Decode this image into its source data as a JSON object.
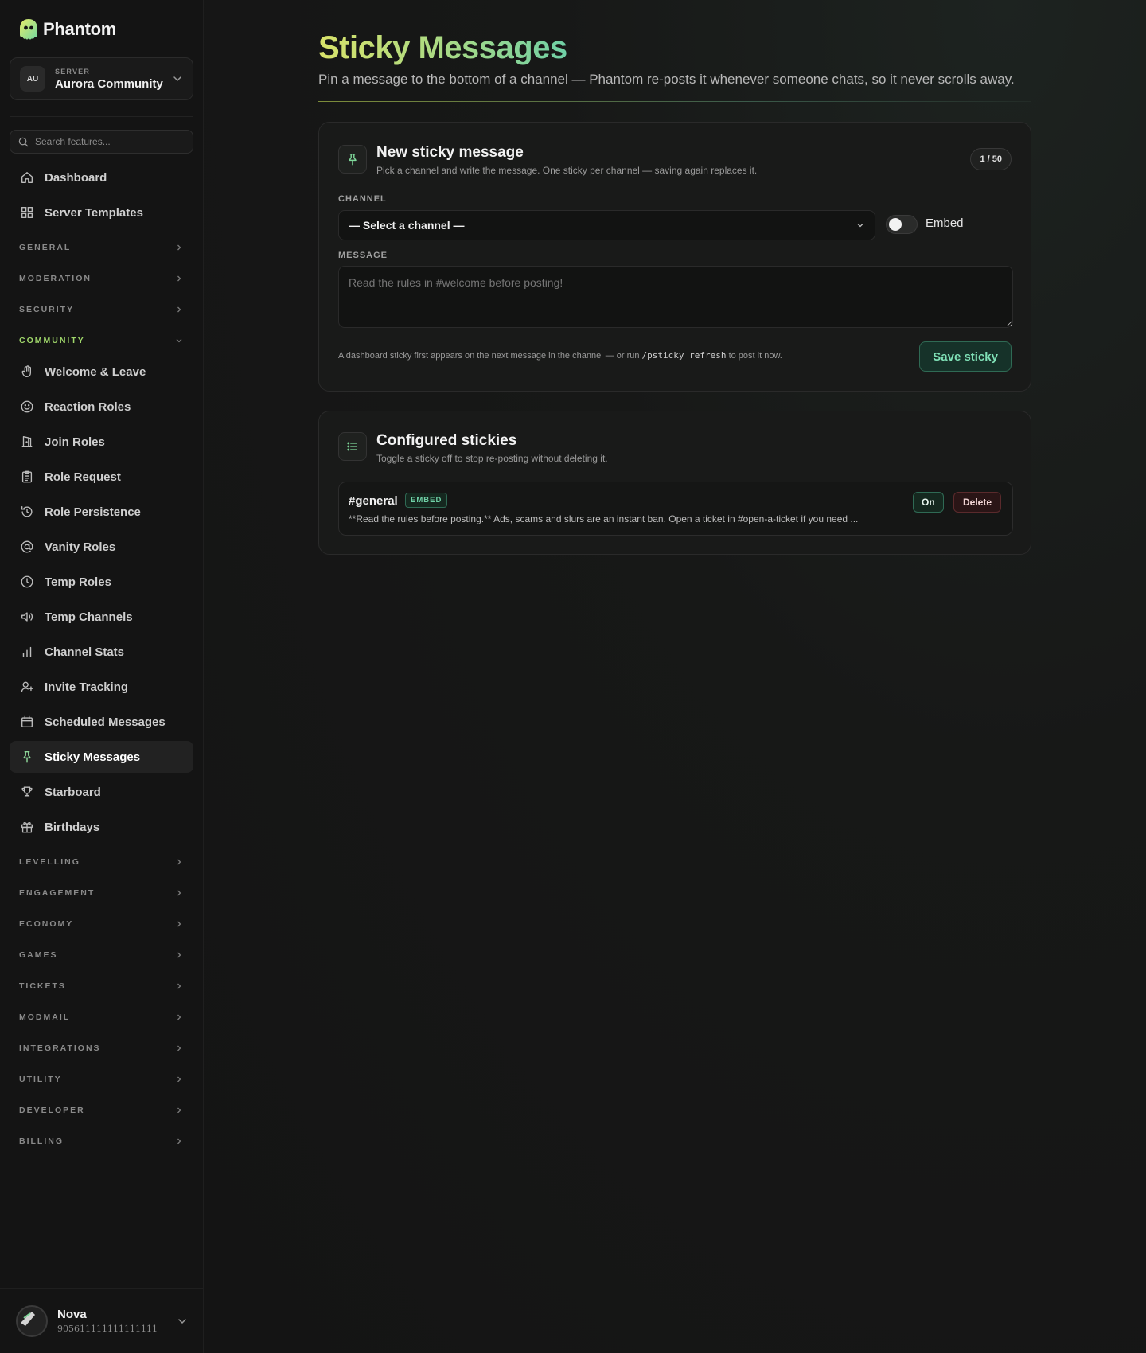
{
  "brand": {
    "name": "Phantom"
  },
  "server": {
    "initials": "AU",
    "label": "SERVER",
    "name": "Aurora Community"
  },
  "search": {
    "placeholder": "Search features..."
  },
  "sidebar": {
    "top_items": [
      {
        "label": "Dashboard",
        "icon": "home-icon"
      },
      {
        "label": "Server Templates",
        "icon": "grid-icon"
      }
    ],
    "sections_before": [
      "GENERAL",
      "MODERATION",
      "SECURITY"
    ],
    "open_section": "COMMUNITY",
    "community_items": [
      {
        "label": "Welcome & Leave",
        "icon": "hand-icon"
      },
      {
        "label": "Reaction Roles",
        "icon": "smile-icon"
      },
      {
        "label": "Join Roles",
        "icon": "door-icon"
      },
      {
        "label": "Role Request",
        "icon": "clipboard-icon"
      },
      {
        "label": "Role Persistence",
        "icon": "history-icon"
      },
      {
        "label": "Vanity Roles",
        "icon": "at-icon"
      },
      {
        "label": "Temp Roles",
        "icon": "clock-icon"
      },
      {
        "label": "Temp Channels",
        "icon": "speaker-icon"
      },
      {
        "label": "Channel Stats",
        "icon": "bar-chart-icon"
      },
      {
        "label": "Invite Tracking",
        "icon": "user-plus-icon"
      },
      {
        "label": "Scheduled Messages",
        "icon": "calendar-icon"
      },
      {
        "label": "Sticky Messages",
        "icon": "pin-icon",
        "active": true
      },
      {
        "label": "Starboard",
        "icon": "trophy-icon"
      },
      {
        "label": "Birthdays",
        "icon": "gift-icon"
      }
    ],
    "sections_after": [
      "LEVELLING",
      "ENGAGEMENT",
      "ECONOMY",
      "GAMES",
      "TICKETS",
      "MODMAIL",
      "INTEGRATIONS",
      "UTILITY",
      "DEVELOPER",
      "BILLING"
    ]
  },
  "user": {
    "name": "Nova",
    "id": "905611111111111111"
  },
  "page": {
    "title": "Sticky Messages",
    "subtitle": "Pin a message to the bottom of a channel — Phantom re-posts it whenever someone chats, so it never scrolls away."
  },
  "new_card": {
    "title": "New sticky message",
    "description": "Pick a channel and write the message. One sticky per channel — saving again replaces it.",
    "count": "1 / 50",
    "channel_label": "CHANNEL",
    "channel_value": "— Select a channel —",
    "embed_label": "Embed",
    "embed_on": false,
    "message_label": "MESSAGE",
    "message_placeholder": "Read the rules in #welcome before posting!",
    "hint_before": "A dashboard sticky first appears on the next message in the channel — or run ",
    "hint_command": "/psticky refresh",
    "hint_after": " to post it now.",
    "save_label": "Save sticky"
  },
  "configured_card": {
    "title": "Configured stickies",
    "description": "Toggle a sticky off to stop re-posting without deleting it.",
    "items": [
      {
        "channel": "#general",
        "badge": "EMBED",
        "message": "**Read the rules before posting.** Ads, scams and slurs are an instant ban. Open a ticket in #open-a-ticket if you need ...",
        "on_label": "On",
        "delete_label": "Delete"
      }
    ]
  },
  "colors": {
    "accent_green": "#6fd0a6",
    "title_gradient_start": "#d9e36a",
    "section_open": "#9fd66a",
    "danger": "#5a2a2c"
  }
}
